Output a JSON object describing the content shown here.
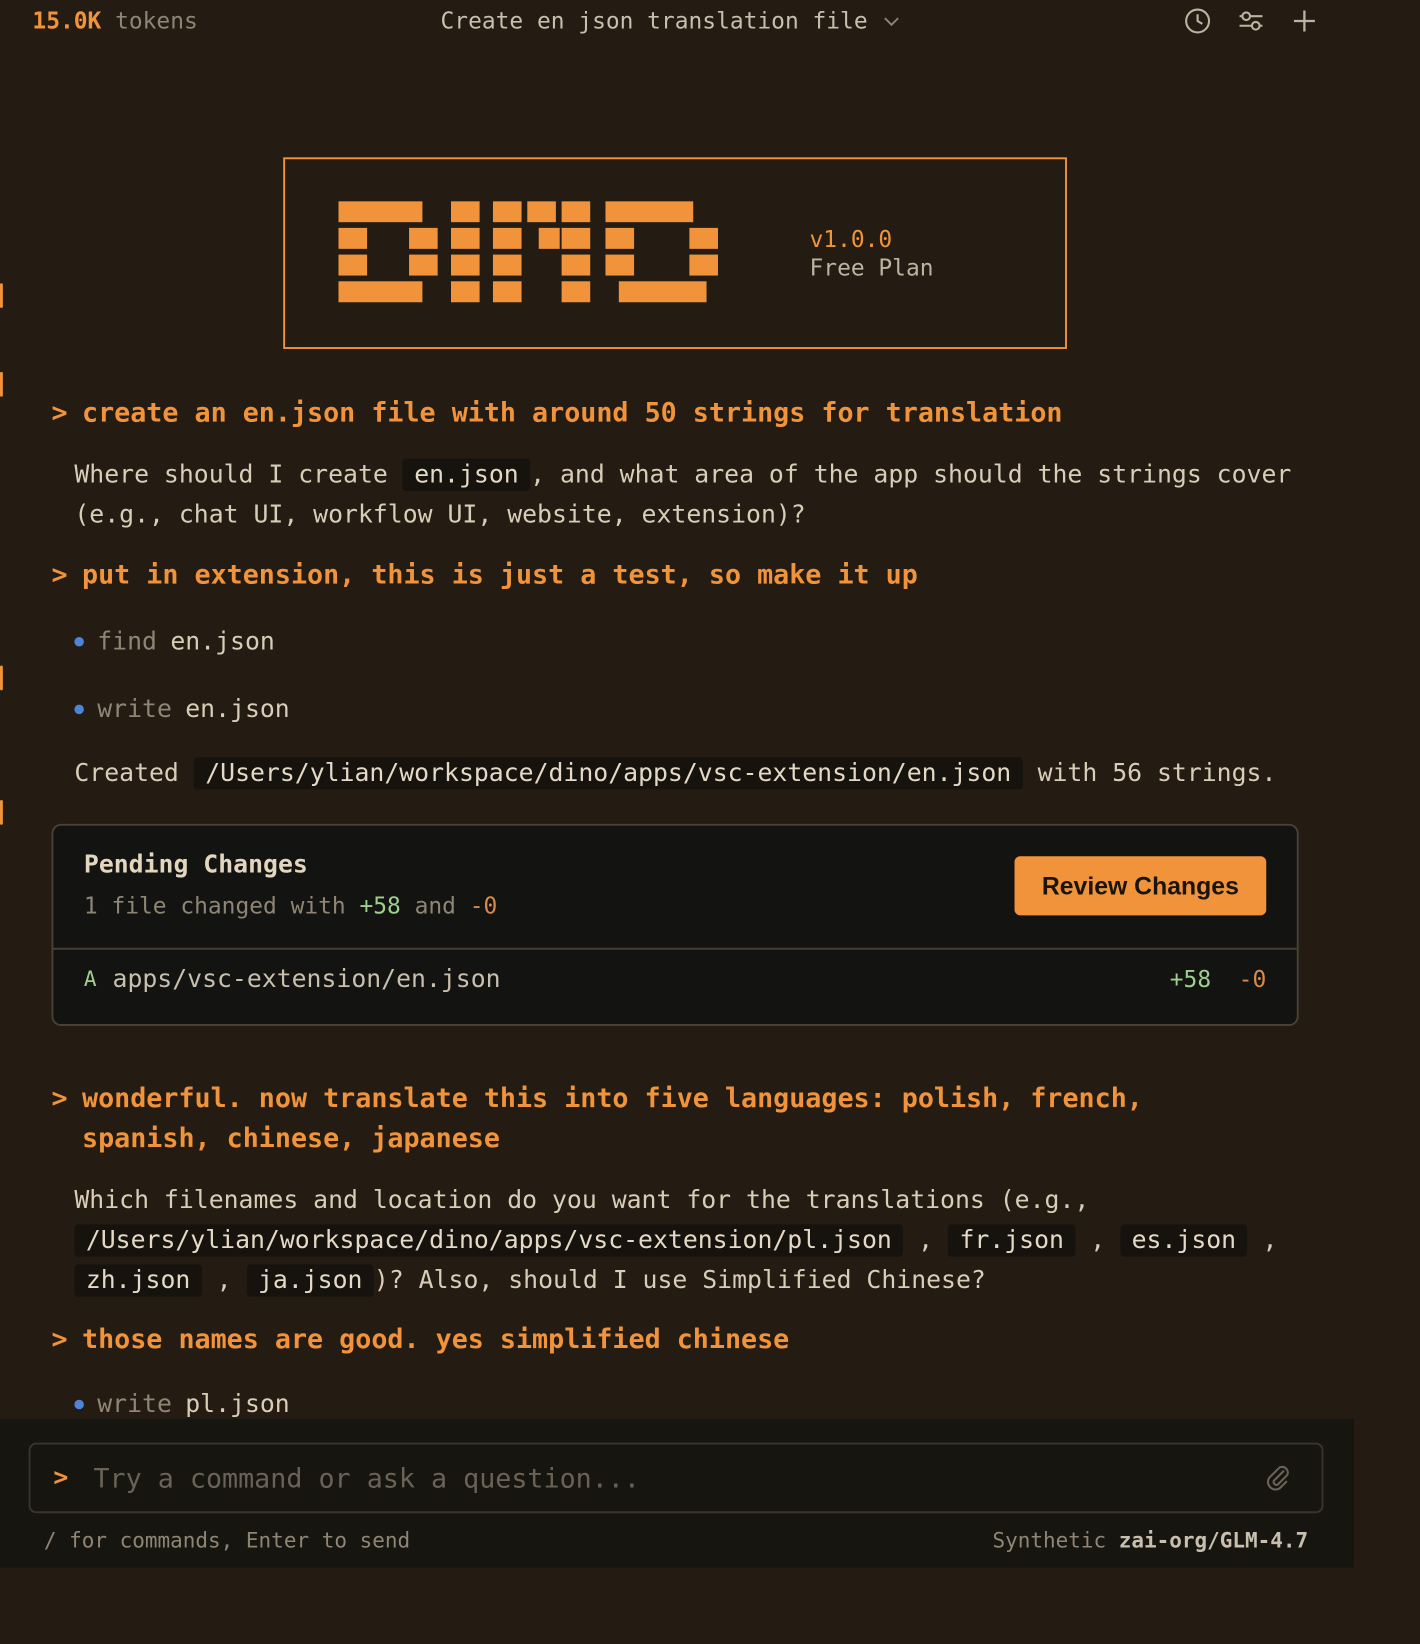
{
  "topbar": {
    "tokens_value": "15.0K",
    "tokens_label": "tokens",
    "title": "Create en json translation file",
    "icons": [
      "history-icon",
      "settings-sliders-icon",
      "new-chat-icon"
    ]
  },
  "banner": {
    "logo_text": "DINO",
    "version": "v1.0.0",
    "plan": "Free Plan"
  },
  "conversation": {
    "prompt_caret": ">",
    "prompt1": "create an en.json file with around 50 strings for translation",
    "reply1_a": "Where should I create",
    "reply1_code": "en.json",
    "reply1_b": ", and what area of the app should the strings cover (e.g., chat UI, workflow UI, website, extension)?",
    "prompt2": "put in extension, this is just a test, so make it up",
    "tool1_verb": "find",
    "tool1_arg": "en.json",
    "tool2_verb": "write",
    "tool2_arg": "en.json",
    "reply2_a": "Created",
    "reply2_code": "/Users/ylian/workspace/dino/apps/vsc-extension/en.json",
    "reply2_b": "with 56 strings.",
    "prompt3": "wonderful. now translate this into five languages: polish, french, spanish, chinese, japanese",
    "reply3_a": "Which filenames and location do you want for the translations (e.g.,",
    "reply3_code1": "/Users/ylian/workspace/dino/apps/vsc-extension/pl.json",
    "reply3_code2": "fr.json",
    "reply3_code3": "es.json",
    "reply3_code4": "zh.json",
    "reply3_code5": "ja.json",
    "reply3_b": ")? Also, should I use Simplified Chinese?",
    "prompt4": "those names are good. yes simplified chinese",
    "tool3_verb": "write",
    "tool3_arg": "pl.json"
  },
  "pending": {
    "title": "Pending Changes",
    "sub_a": "1 file changed with",
    "sub_plus": "+58",
    "sub_and": "and",
    "sub_minus": "-0",
    "review_label": "Review Changes",
    "file_status": "A",
    "file_path": "apps/vsc-extension/en.json",
    "file_plus": "+58",
    "file_minus": "-0"
  },
  "composer": {
    "caret": ">",
    "placeholder": "Try a command or ask a question...",
    "hint": "/ for commands, Enter to send",
    "provider": "Synthetic",
    "model": "zai-org/GLM-4.7"
  },
  "colors": {
    "accent": "#f0933a",
    "background": "#241c12",
    "bullet": "#4d84d9",
    "added": "#9fcf8f"
  }
}
